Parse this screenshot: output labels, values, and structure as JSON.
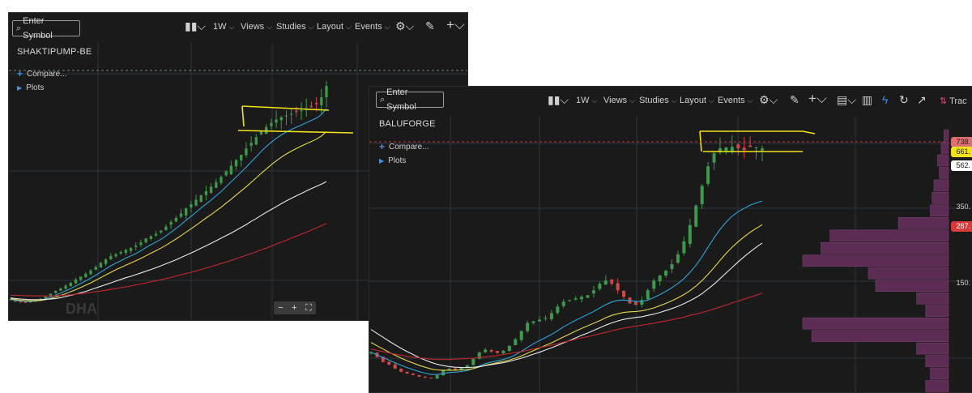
{
  "colors": {
    "background": "#1a1a1a",
    "grid": "#2c3540",
    "bull": "#3e9a4a",
    "bear": "#d04848",
    "ema_fast": "#2fa3d8",
    "ema_mid": "#e8d64a",
    "ema_slow": "#e8e8e8",
    "ema_long": "#c0282b",
    "annotation": "#f2e21a",
    "volume_profile": "#5c2c54"
  },
  "panel1": {
    "toolbar": {
      "search_placeholder": "Enter Symbol",
      "interval": "1W",
      "views": "Views",
      "studies": "Studies",
      "layout": "Layout",
      "events": "Events"
    },
    "ticker": "SHAKTIPUMP-BE",
    "compare_label": "Compare...",
    "plots_label": "Plots",
    "watermark": "DHA",
    "zoom": {
      "minus": "−",
      "plus": "+",
      "fit": "⛶"
    }
  },
  "panel2": {
    "toolbar": {
      "search_placeholder": "Enter Symbol",
      "interval": "1W",
      "views": "Views",
      "studies": "Studies",
      "layout": "Layout",
      "events": "Events",
      "trade": "Trac"
    },
    "ticker": "BALUFORGE",
    "compare_label": "Compare...",
    "plots_label": "Plots",
    "price_labels": [
      {
        "text": "738.",
        "bg": "#e07070",
        "fg": "#1a1a1a"
      },
      {
        "text": "661.",
        "bg": "#f2e21a",
        "fg": "#1a1a1a"
      },
      {
        "text": "562.",
        "bg": "#ffffff",
        "fg": "#1a1a1a"
      },
      {
        "text": "350.",
        "bg": "",
        "fg": "#cfcfcf"
      },
      {
        "text": "287.",
        "bg": "#d83a3a",
        "fg": "#ffffff"
      },
      {
        "text": "150.",
        "bg": "",
        "fg": "#cfcfcf"
      }
    ]
  },
  "chart_data": [
    {
      "type": "line",
      "title": "SHAKTIPUMP-BE",
      "series": [
        {
          "values": [
            70,
            62,
            60,
            58,
            62,
            66,
            72,
            80,
            90,
            100,
            108,
            118,
            128,
            140,
            150,
            160,
            172,
            184,
            198,
            210,
            222,
            228,
            236,
            244,
            250,
            258,
            270,
            284,
            292,
            300,
            312,
            326,
            342,
            356,
            372,
            390,
            404,
            420,
            436,
            450,
            466,
            482,
            500,
            520,
            540,
            560,
            578,
            600,
            620,
            640,
            660,
            676,
            690,
            702,
            710,
            716,
            722,
            728,
            734,
            740,
            746,
            756,
            780,
            820
          ]
        },
        {
          "name": "",
          "values": [
            70,
            66,
            64,
            63,
            63,
            64,
            67,
            72,
            78,
            85,
            92,
            100,
            108,
            117,
            126,
            135,
            145,
            155,
            166,
            177,
            188,
            197,
            206,
            215,
            223,
            231,
            241,
            252,
            262,
            271,
            281,
            293,
            306,
            319,
            333,
            348,
            362,
            376,
            391,
            405,
            419,
            434,
            449,
            466,
            483,
            500,
            517,
            535,
            553,
            571,
            590,
            607,
            622,
            636,
            648,
            658,
            667,
            675,
            683,
            691,
            699,
            707,
            720,
            740
          ]
        },
        {
          "name": "",
          "values": [
            72,
            69,
            67,
            65,
            65,
            65,
            66,
            69,
            73,
            78,
            84,
            90,
            97,
            104,
            112,
            120,
            128,
            137,
            146,
            156,
            165,
            174,
            182,
            190,
            198,
            206,
            214,
            223,
            232,
            241,
            250,
            260,
            271,
            282,
            294,
            306,
            318,
            330,
            343,
            356,
            368,
            381,
            394,
            408,
            422,
            437,
            451,
            466,
            481,
            497,
            513,
            528,
            543,
            557,
            570,
            581,
            591,
            600,
            609,
            617,
            625,
            633,
            644,
            660
          ]
        },
        {
          "name": "",
          "values": [
            75,
            73,
            71,
            70,
            69,
            69,
            69,
            70,
            71,
            73,
            76,
            80,
            84,
            88,
            93,
            98,
            104,
            110,
            116,
            122,
            128,
            134,
            140,
            146,
            151,
            157,
            163,
            169,
            175,
            181,
            188,
            195,
            202,
            209,
            217,
            225,
            233,
            241,
            250,
            258,
            267,
            276,
            285,
            294,
            303,
            313,
            323,
            333,
            344,
            354,
            365,
            376,
            386,
            396,
            406,
            416,
            425,
            434,
            442,
            451,
            459,
            467,
            475,
            484
          ]
        },
        {
          "name": "",
          "values": [
            85,
            84,
            84,
            83,
            83,
            82,
            82,
            82,
            82,
            83,
            84,
            85,
            86,
            88,
            90,
            92,
            94,
            97,
            99,
            102,
            105,
            108,
            111,
            114,
            117,
            121,
            124,
            128,
            132,
            135,
            139,
            143,
            147,
            152,
            156,
            161,
            165,
            170,
            175,
            180,
            185,
            190,
            196,
            201,
            207,
            213,
            219,
            225,
            231,
            237,
            244,
            250,
            257,
            264,
            271,
            278,
            285,
            292,
            299,
            306,
            314,
            321,
            329,
            337
          ]
        }
      ],
      "ylim": [
        0,
        900
      ]
    },
    {
      "type": "line",
      "title": "BALUFORGE",
      "series": [
        {
          "values": [
            110,
            95,
            80,
            72,
            60,
            50,
            45,
            40,
            35,
            32,
            30,
            40,
            55,
            60,
            55,
            62,
            70,
            90,
            110,
            118,
            112,
            108,
            115,
            130,
            150,
            175,
            200,
            205,
            210,
            215,
            230,
            250,
            265,
            270,
            275,
            280,
            285,
            300,
            320,
            330,
            320,
            300,
            280,
            260,
            255,
            270,
            300,
            330,
            345,
            360,
            380,
            410,
            450,
            500,
            560,
            620,
            680,
            720,
            735,
            738,
            740,
            735,
            730,
            740,
            738,
            735
          ]
        },
        {
          "name": "",
          "values": [
            110,
            102,
            94,
            86,
            78,
            70,
            63,
            57,
            51,
            46,
            42,
            42,
            45,
            48,
            49,
            51,
            54,
            60,
            68,
            75,
            80,
            84,
            88,
            94,
            102,
            113,
            125,
            136,
            146,
            155,
            165,
            176,
            188,
            198,
            208,
            217,
            226,
            235,
            246,
            256,
            264,
            269,
            270,
            268,
            266,
            266,
            270,
            278,
            287,
            297,
            308,
            321,
            336,
            355,
            377,
            403,
            432,
            461,
            487,
            509,
            527,
            541,
            551,
            561,
            568,
            574
          ]
        },
        {
          "name": "",
          "values": [
            140,
            130,
            120,
            110,
            101,
            92,
            84,
            77,
            70,
            64,
            59,
            56,
            55,
            55,
            55,
            56,
            57,
            60,
            65,
            70,
            74,
            78,
            82,
            86,
            92,
            99,
            107,
            115,
            123,
            131,
            139,
            148,
            157,
            166,
            175,
            183,
            191,
            199,
            207,
            216,
            223,
            228,
            232,
            234,
            235,
            237,
            241,
            246,
            253,
            260,
            268,
            277,
            287,
            299,
            313,
            330,
            349,
            370,
            392,
            413,
            432,
            449,
            464,
            478,
            490,
            501
          ]
        },
        {
          "name": "",
          "values": [
            180,
            168,
            156,
            144,
            133,
            122,
            112,
            103,
            94,
            86,
            79,
            73,
            69,
            66,
            64,
            63,
            63,
            64,
            66,
            69,
            72,
            75,
            78,
            82,
            87,
            92,
            98,
            104,
            110,
            117,
            124,
            131,
            139,
            146,
            154,
            162,
            169,
            177,
            185,
            193,
            200,
            206,
            211,
            214,
            217,
            219,
            223,
            227,
            232,
            238,
            244,
            251,
            259,
            268,
            278,
            290,
            304,
            319,
            336,
            353,
            370,
            387,
            403,
            418,
            432,
            445
          ]
        },
        {
          "name": "",
          "values": [
            120,
            116,
            112,
            108,
            104,
            101,
            98,
            95,
            93,
            91,
            89,
            88,
            88,
            88,
            89,
            90,
            91,
            92,
            94,
            96,
            98,
            100,
            103,
            106,
            109,
            112,
            116,
            120,
            124,
            128,
            132,
            136,
            141,
            145,
            150,
            154,
            158,
            162,
            167,
            171,
            176,
            180,
            184,
            187,
            190,
            193,
            196,
            199,
            203,
            206,
            210,
            214,
            218,
            223,
            227,
            232,
            237,
            243,
            249,
            255,
            261,
            267,
            273,
            279,
            285,
            292
          ]
        }
      ],
      "volume_profile": [
        5,
        8,
        12,
        10,
        16,
        18,
        20,
        55,
        130,
        140,
        160,
        88,
        80,
        35,
        25,
        160,
        150,
        35,
        25,
        20,
        25
      ],
      "ylim": [
        0,
        800
      ]
    }
  ]
}
